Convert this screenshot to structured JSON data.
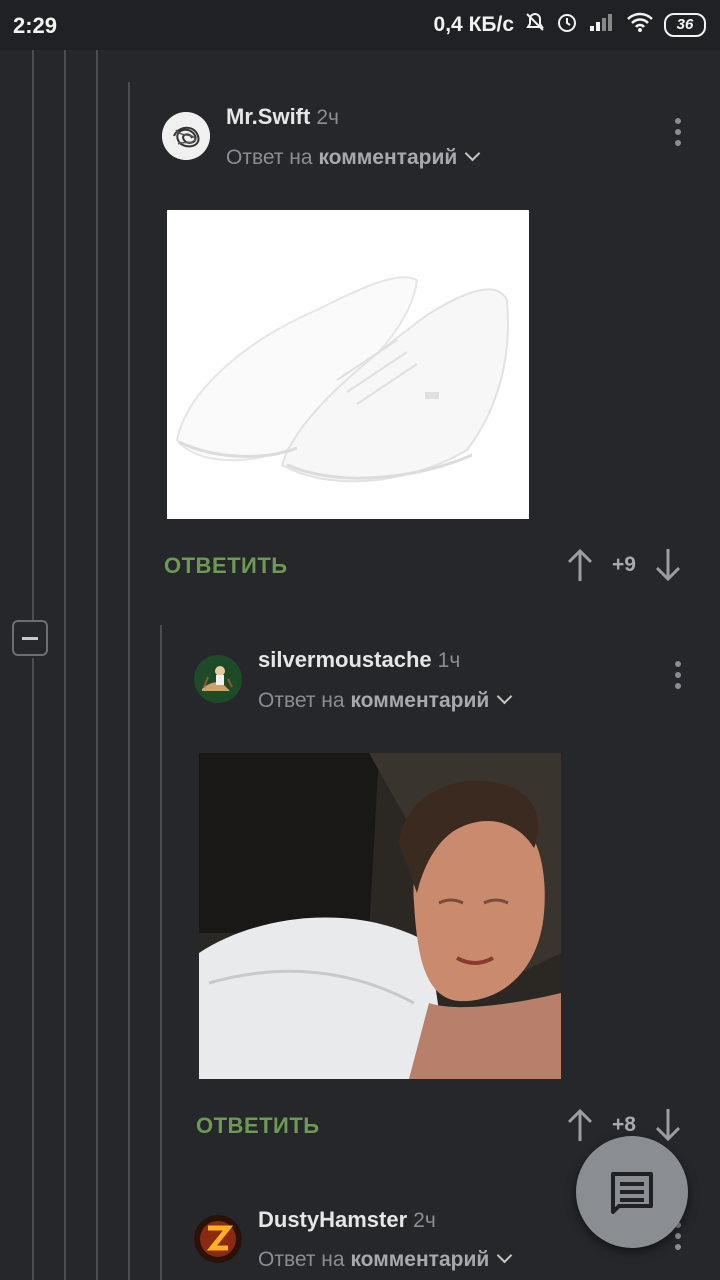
{
  "status": {
    "time": "2:29",
    "net_speed": "0,4 КБ/с",
    "battery": "36"
  },
  "comments": [
    {
      "author": "Mr.Swift",
      "time": "2ч",
      "reply_prefix": "Ответ на",
      "reply_target": "комментарий",
      "reply_label": "ОТВЕТИТЬ",
      "score": "+9"
    },
    {
      "author": "silvermoustache",
      "time": "1ч",
      "reply_prefix": "Ответ на",
      "reply_target": "комментарий",
      "reply_label": "ОТВЕТИТЬ",
      "score": "+8"
    },
    {
      "author": "DustyHamster",
      "time": "2ч",
      "reply_prefix": "Ответ на",
      "reply_target": "комментарий"
    }
  ],
  "icons": [
    "mute-icon",
    "alarm-icon",
    "signal-icon",
    "wifi-icon",
    "battery-icon",
    "kebab-icon",
    "upvote-icon",
    "downvote-icon",
    "comment-icon",
    "collapse-icon"
  ],
  "colors": {
    "background": "#25272b",
    "accent_green": "#6c9a53",
    "muted": "#8a8d92"
  }
}
